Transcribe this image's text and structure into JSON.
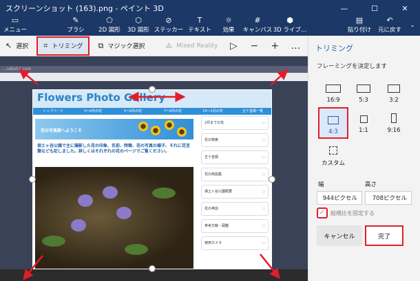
{
  "window": {
    "title": "スクリーンショット (163).png - ペイント 3D",
    "minimize": "—",
    "maximize": "☐",
    "close": "✕"
  },
  "ribbon": {
    "left": [
      {
        "label": "メニュー",
        "icon": "folder-icon"
      },
      {
        "label": "ブラシ",
        "icon": "brush-icon"
      },
      {
        "label": "2D 図形",
        "icon": "2d-shapes-icon"
      },
      {
        "label": "3D 図形",
        "icon": "3d-shapes-icon"
      },
      {
        "label": "ステッカー",
        "icon": "stickers-icon"
      },
      {
        "label": "テキスト",
        "icon": "text-icon"
      },
      {
        "label": "効果",
        "icon": "effects-icon"
      },
      {
        "label": "キャンバス",
        "icon": "canvas-icon"
      },
      {
        "label": "3D ライブ...",
        "icon": "3d-library-icon"
      }
    ],
    "right": [
      {
        "label": "貼り付け",
        "icon": "paste-icon"
      },
      {
        "label": "元に戻す",
        "icon": "undo-icon"
      }
    ],
    "more": "⌄"
  },
  "toolbar": {
    "select": "選択",
    "trim": "トリミング",
    "magic_select": "マジック選択",
    "mixed_reality": "Mixed Reality",
    "more": "…"
  },
  "panel": {
    "title": "トリミング",
    "subtitle": "フレーミングを決定します",
    "ratios": [
      {
        "label": "16:9",
        "selected": false
      },
      {
        "label": "5:3",
        "selected": false
      },
      {
        "label": "3:2",
        "selected": false
      },
      {
        "label": "4:3",
        "selected": true
      },
      {
        "label": "1:1",
        "selected": false
      },
      {
        "label": "9:16",
        "selected": false
      },
      {
        "label": "カスタム",
        "selected": false
      }
    ],
    "width_label": "幅",
    "height_label": "高さ",
    "width_value": "944ピクセル",
    "height_value": "708ピクセル",
    "lock_label": "縦横比を固定する",
    "lock_checked": true,
    "cancel": "キャンセル",
    "done": "完了"
  },
  "canvas": {
    "background_address": "…udio52.com",
    "site": {
      "title": "Flowers Photo Gallery",
      "nav": [
        "トップページ",
        "3〜4月の花",
        "5〜6月の花",
        "7〜9月の花",
        "10〜1月の花",
        "五十音順一覧"
      ],
      "banner": "花の写真館へようこそ",
      "intro": "保土ヶ谷公園で主に撮影した花の印象、名前、特徴、花の写真の様子、それに花言葉なども記しました。詳しくはそれぞれの花のページでご覧ください。",
      "sidebar": [
        "2月までの花",
        "花の検索",
        "五十音順",
        "花の用語集",
        "保土ヶ谷公園概要",
        "花の神話",
        "参考文献・図鑑",
        "使用カメラ"
      ]
    }
  },
  "colors": {
    "accent": "#1f5fa8",
    "highlight": "#e21d2b",
    "titlebar": "#1b3866"
  }
}
